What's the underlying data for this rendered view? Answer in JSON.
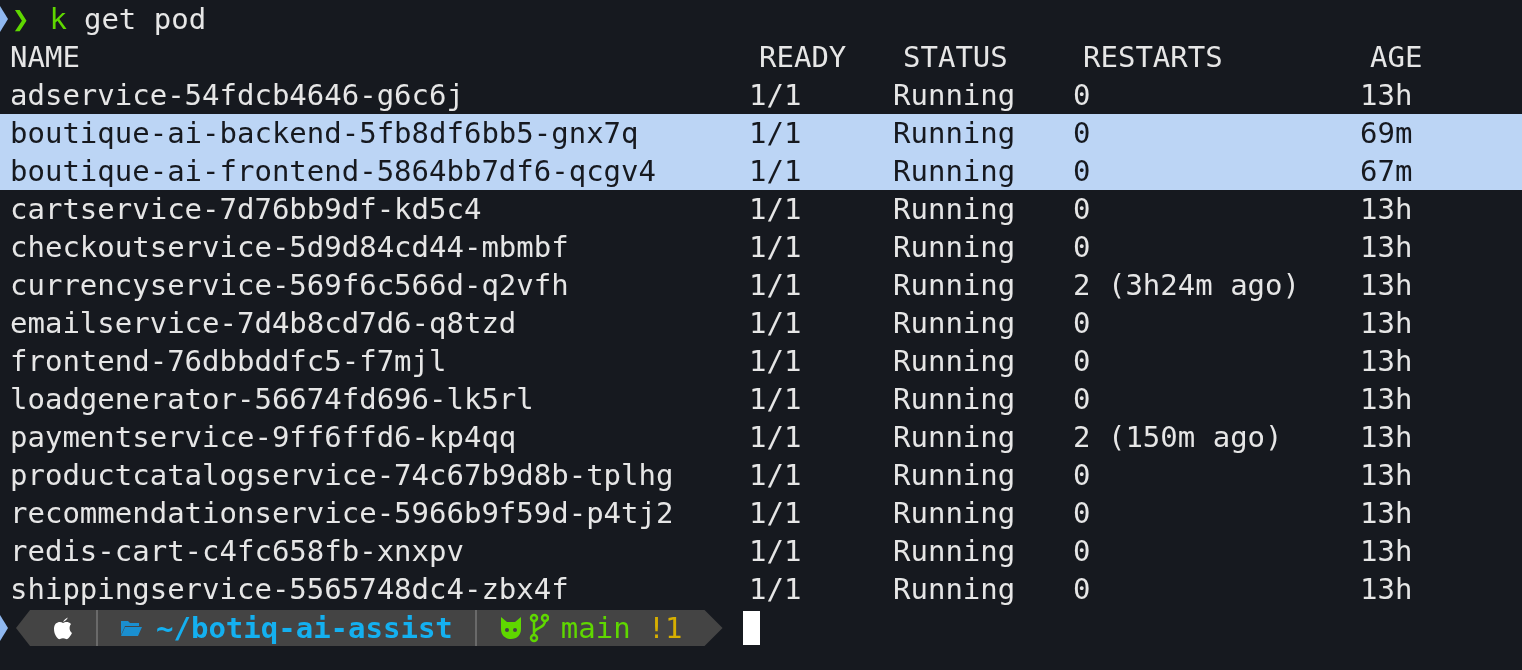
{
  "prompt": {
    "symbol": "❯",
    "command": "k",
    "args": "get pod"
  },
  "table": {
    "columns": [
      "NAME",
      "READY",
      "STATUS",
      "RESTARTS",
      "AGE"
    ],
    "rows": [
      {
        "cells": [
          "adservice-54fdcb4646-g6c6j",
          "1/1",
          "Running",
          "0",
          "13h"
        ],
        "selected": false
      },
      {
        "cells": [
          "boutique-ai-backend-5fb8df6bb5-gnx7q",
          "1/1",
          "Running",
          "0",
          "69m"
        ],
        "selected": true
      },
      {
        "cells": [
          "boutique-ai-frontend-5864bb7df6-qcgv4",
          "1/1",
          "Running",
          "0",
          "67m"
        ],
        "selected": true
      },
      {
        "cells": [
          "cartservice-7d76bb9df-kd5c4",
          "1/1",
          "Running",
          "0",
          "13h"
        ],
        "selected": false
      },
      {
        "cells": [
          "checkoutservice-5d9d84cd44-mbmbf",
          "1/1",
          "Running",
          "0",
          "13h"
        ],
        "selected": false
      },
      {
        "cells": [
          "currencyservice-569f6c566d-q2vfh",
          "1/1",
          "Running",
          "2 (3h24m ago)",
          "13h"
        ],
        "selected": false
      },
      {
        "cells": [
          "emailservice-7d4b8cd7d6-q8tzd",
          "1/1",
          "Running",
          "0",
          "13h"
        ],
        "selected": false
      },
      {
        "cells": [
          "frontend-76dbbddfc5-f7mjl",
          "1/1",
          "Running",
          "0",
          "13h"
        ],
        "selected": false
      },
      {
        "cells": [
          "loadgenerator-56674fd696-lk5rl",
          "1/1",
          "Running",
          "0",
          "13h"
        ],
        "selected": false
      },
      {
        "cells": [
          "paymentservice-9ff6ffd6-kp4qq",
          "1/1",
          "Running",
          "2 (150m ago)",
          "13h"
        ],
        "selected": false
      },
      {
        "cells": [
          "productcatalogservice-74c67b9d8b-tplhg",
          "1/1",
          "Running",
          "0",
          "13h"
        ],
        "selected": false
      },
      {
        "cells": [
          "recommendationservice-5966b9f59d-p4tj2",
          "1/1",
          "Running",
          "0",
          "13h"
        ],
        "selected": false
      },
      {
        "cells": [
          "redis-cart-c4fc658fb-xnxpv",
          "1/1",
          "Running",
          "0",
          "13h"
        ],
        "selected": false
      },
      {
        "cells": [
          "shippingservice-5565748dc4-zbx4f",
          "1/1",
          "Running",
          "0",
          "13h"
        ],
        "selected": false
      }
    ]
  },
  "status_line": {
    "path": "~/botiq-ai-assist",
    "branch": "main",
    "changes": "!1"
  }
}
